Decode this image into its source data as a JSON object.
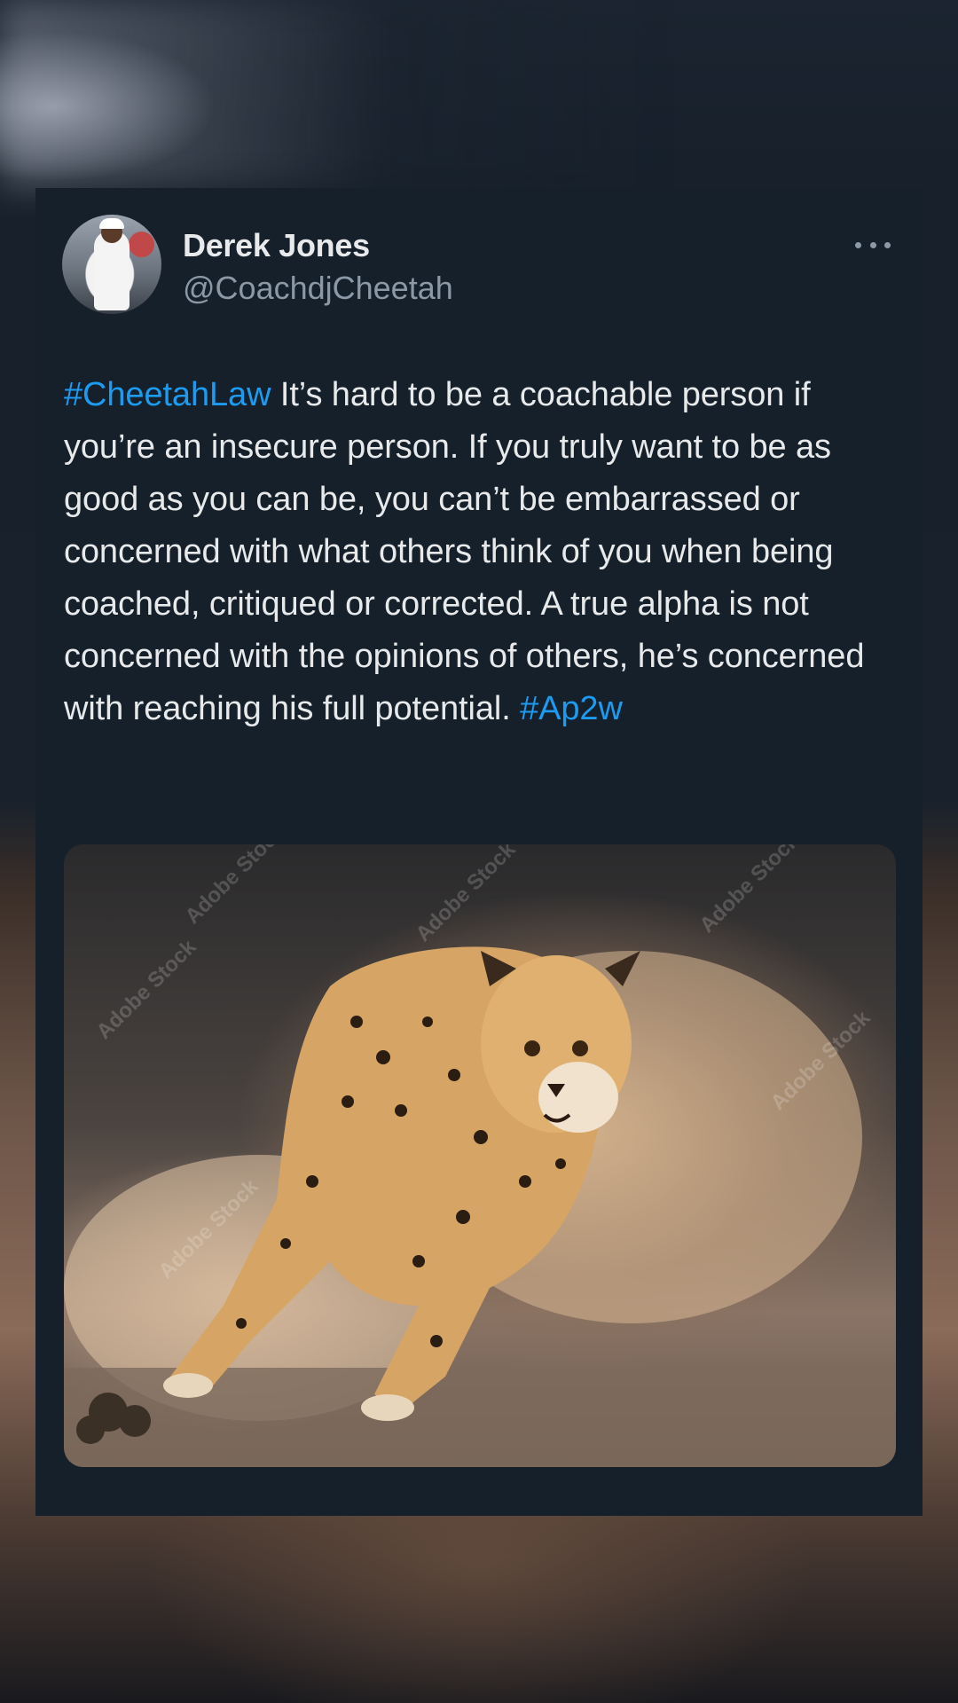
{
  "tweet": {
    "author": {
      "display_name": "Derek Jones",
      "handle": "@CoachdjCheetah"
    },
    "text": {
      "hashtag_lead": "#CheetahLaw",
      "body": " It’s hard to be a coachable person if you’re an insecure person. If you truly want to be as good as you can be, you can’t be embarrassed or concerned with what others think of you when being coached, critiqued or corrected. A true alpha is not concerned with the opinions of others, he’s concerned with reaching his full potential. ",
      "hashtag_trail": "#Ap2w"
    },
    "media": {
      "watermarks": [
        "Adobe Stock",
        "Adobe Stock",
        "Adobe Stock",
        "Adobe Stock",
        "Adobe Stock",
        "Adobe Stock"
      ]
    }
  },
  "icons": {
    "more": "more-horizontal-icon"
  },
  "colors": {
    "card_background": "#15202b",
    "text_primary": "#e7e9ea",
    "text_secondary": "#8b98a5",
    "link": "#1d9bf0"
  }
}
